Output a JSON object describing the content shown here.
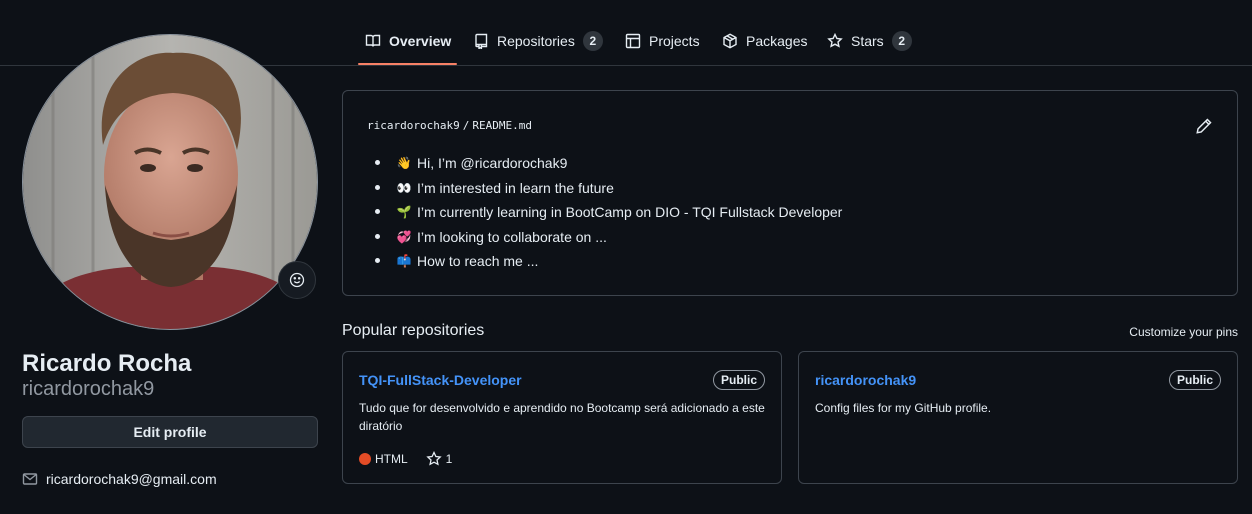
{
  "nav": {
    "tabs": [
      {
        "label": "Overview",
        "icon": "book-icon"
      },
      {
        "label": "Repositories",
        "icon": "repo-icon",
        "count": "2"
      },
      {
        "label": "Projects",
        "icon": "project-table-icon"
      },
      {
        "label": "Packages",
        "icon": "package-icon"
      },
      {
        "label": "Stars",
        "icon": "star-icon",
        "count": "2"
      }
    ],
    "active_tab": "Overview",
    "accent_color": "#f78166"
  },
  "profile": {
    "fullname": "Ricardo Rocha",
    "username": "ricardorochak9",
    "edit_button": "Edit profile",
    "email": "ricardorochak9@gmail.com",
    "status_icon": "smiley-icon"
  },
  "readme": {
    "owner": "ricardorochak9",
    "separator": "/",
    "file": "README.md",
    "items": [
      {
        "emoji": "👋",
        "text": "Hi, I’m @ricardorochak9"
      },
      {
        "emoji": "👀",
        "text": "I’m interested in learn the future"
      },
      {
        "emoji": "🌱",
        "text": "I’m currently learning in BootCamp on DIO - TQI Fullstack Developer"
      },
      {
        "emoji": "💞️",
        "text": "I’m looking to collaborate on ..."
      },
      {
        "emoji": "📫",
        "text": "How to reach me ..."
      }
    ]
  },
  "popular": {
    "title": "Popular repositories",
    "customize_label": "Customize your pins",
    "repos": [
      {
        "name": "TQI-FullStack-Developer",
        "visibility": "Public",
        "description": "Tudo que for desenvolvido e aprendido no Bootcamp será adicionado a este diratório",
        "language": "HTML",
        "language_color": "#e34c26",
        "stars": "1"
      },
      {
        "name": "ricardorochak9",
        "visibility": "Public",
        "description": "Config files for my GitHub profile."
      }
    ]
  }
}
